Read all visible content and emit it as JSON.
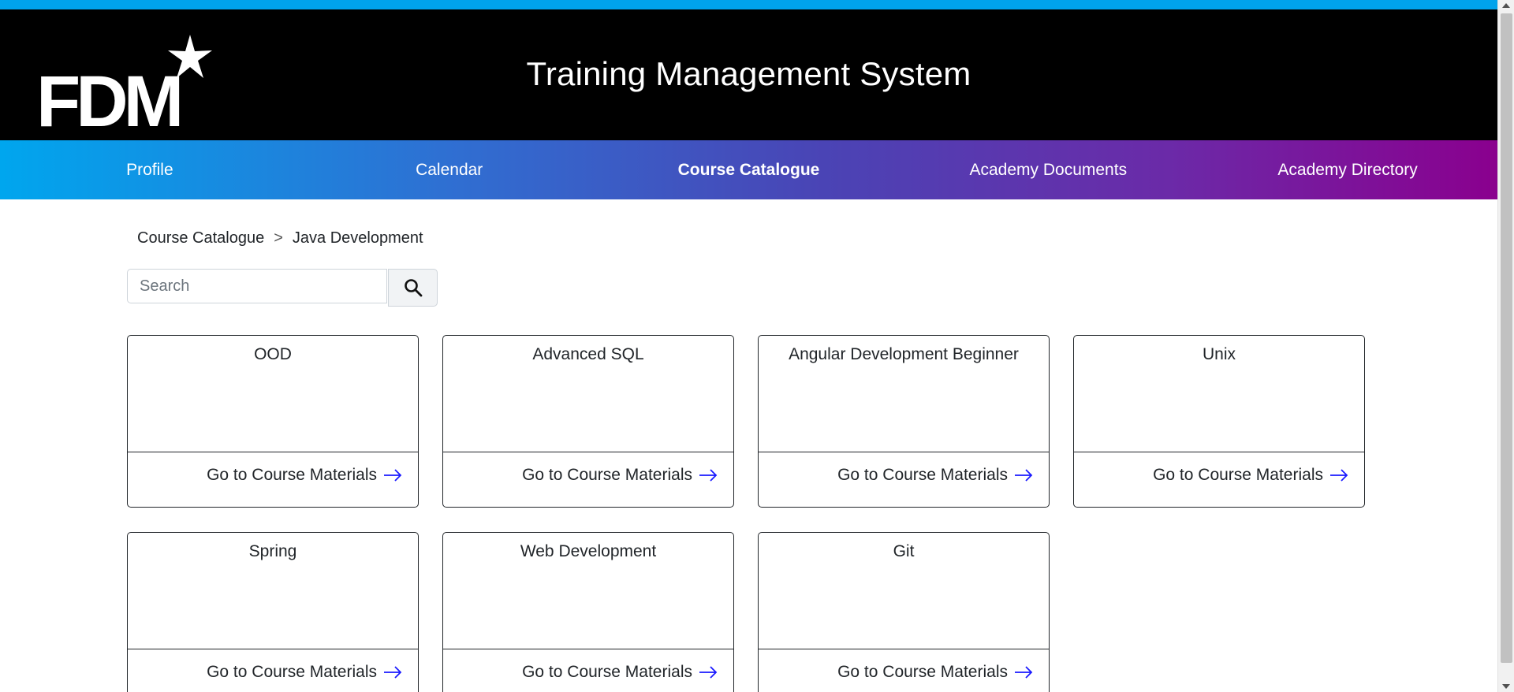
{
  "header": {
    "logo_text": "FDM",
    "title": "Training Management System"
  },
  "nav": {
    "items": [
      {
        "label": "Profile",
        "active": false
      },
      {
        "label": "Calendar",
        "active": false
      },
      {
        "label": "Course Catalogue",
        "active": true
      },
      {
        "label": "Academy Documents",
        "active": false
      },
      {
        "label": "Academy Directory",
        "active": false
      }
    ]
  },
  "breadcrumb": {
    "root": "Course Catalogue",
    "separator": ">",
    "current": "Java Development"
  },
  "search": {
    "placeholder": "Search",
    "value": ""
  },
  "courses": [
    {
      "title": "OOD",
      "link_label": "Go to Course Materials"
    },
    {
      "title": "Advanced SQL",
      "link_label": "Go to Course Materials"
    },
    {
      "title": "Angular Development Beginner",
      "link_label": "Go to Course Materials"
    },
    {
      "title": "Unix",
      "link_label": "Go to Course Materials"
    },
    {
      "title": "Spring",
      "link_label": "Go to Course Materials"
    },
    {
      "title": "Web Development",
      "link_label": "Go to Course Materials"
    },
    {
      "title": "Git",
      "link_label": "Go to Course Materials"
    }
  ],
  "icons": {
    "search": "search-icon",
    "arrow": "arrow-right-icon"
  },
  "colors": {
    "accent_blue": "#00a3ec",
    "accent_purple": "#8a008e",
    "arrow_blue": "#1a1aff"
  }
}
